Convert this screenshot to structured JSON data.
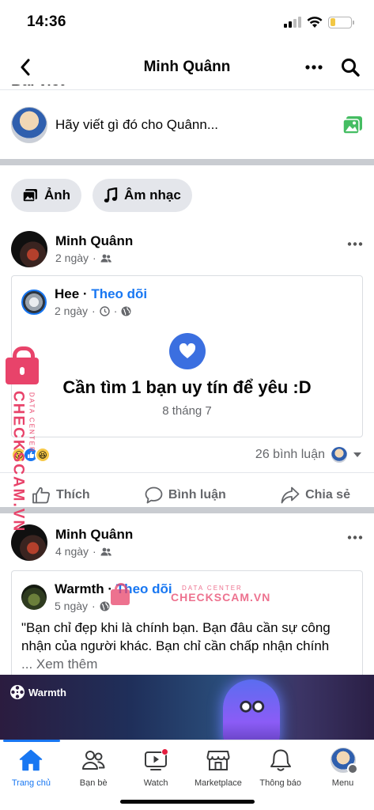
{
  "status_bar": {
    "time": "14:36",
    "battery_level": 0.25,
    "battery_color": "#f2c744"
  },
  "nav": {
    "title": "Minh Quânn",
    "back_icon": "chevron-left-icon",
    "more_icon": "more-icon",
    "search_icon": "search-icon"
  },
  "clipped_heading": "Bài viết",
  "composer": {
    "placeholder": "Hãy viết gì đó cho Quânn...",
    "photo_icon": "photo-icon",
    "photo_icon_color": "#45bd62"
  },
  "chips": [
    {
      "label": "Ảnh",
      "icon": "photo-album-icon"
    },
    {
      "label": "Âm nhạc",
      "icon": "music-note-icon"
    }
  ],
  "post1": {
    "author": "Minh Quânn",
    "time": "2 ngày",
    "audience_icon": "friends-icon",
    "shared": {
      "author": "Hee",
      "follow_label": "Theo dõi",
      "time": "2 ngày",
      "event_title": "Cần tìm 1 bạn uy tín để yêu :D",
      "event_date": "8 tháng 7",
      "heart_color": "#3b6fe0"
    },
    "comments": "26 bình luận",
    "actions": {
      "like": "Thích",
      "comment": "Bình luận",
      "share": "Chia sẻ"
    }
  },
  "post2": {
    "author": "Minh Quânn",
    "time": "4 ngày",
    "shared": {
      "author": "Warmth",
      "follow_label": "Theo dõi",
      "time": "5 ngày",
      "text": "\"Bạn chỉ đẹp khi là chính bạn. Bạn đâu cần sự công nhận của người khác. Bạn chỉ cần chấp nhận chính",
      "see_more": "... Xem thêm",
      "media_label": "Warmth"
    }
  },
  "tabs": [
    {
      "label": "Trang chủ",
      "icon": "home-icon",
      "active": true
    },
    {
      "label": "Bạn bè",
      "icon": "friends-icon"
    },
    {
      "label": "Watch",
      "icon": "watch-icon"
    },
    {
      "label": "Marketplace",
      "icon": "marketplace-icon"
    },
    {
      "label": "Thông báo",
      "icon": "bell-icon"
    },
    {
      "label": "Menu",
      "icon": "menu-avatar-icon"
    }
  ],
  "watermark": {
    "brand": "CHECKSCAM.VN",
    "tagline": "DATA CENTER",
    "color": "#e8436a"
  },
  "colors": {
    "accent": "#1877f2",
    "secondary_text": "#65676b"
  }
}
